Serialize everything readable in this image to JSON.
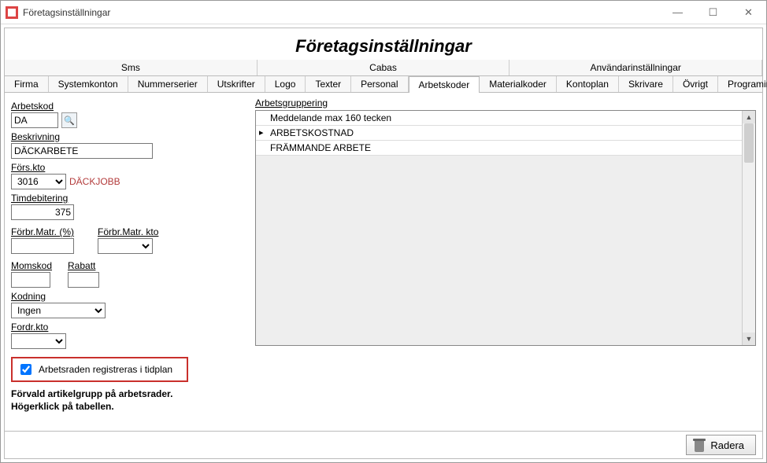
{
  "window": {
    "title": "Företagsinställningar"
  },
  "header": {
    "title": "Företagsinställningar"
  },
  "tabs_row1": [
    "Sms",
    "Cabas",
    "Användarinställningar"
  ],
  "tabs_row2": [
    "Firma",
    "Systemkonton",
    "Nummerserier",
    "Utskrifter",
    "Logo",
    "Texter",
    "Personal",
    "Arbetskoder",
    "Materialkoder",
    "Kontoplan",
    "Skrivare",
    "Övrigt",
    "Programinställningar"
  ],
  "active_tab_row2": "Arbetskoder",
  "left": {
    "arbetskod_label": "Arbetskod",
    "arbetskod_value": "DA",
    "beskrivning_label": "Beskrivning",
    "beskrivning_value": "DÄCKARBETE",
    "forskto_label": "Förs.kto",
    "forskto_value": "3016",
    "forskto_name": "DÄCKJOBB",
    "timdeb_label": "Timdebitering",
    "timdeb_value": "375",
    "forbr_pct_label": "Förbr.Matr. (%)",
    "forbr_pct_value": "",
    "forbr_kto_label": "Förbr.Matr. kto",
    "forbr_kto_value": "",
    "momskod_label": "Momskod",
    "momskod_value": "",
    "rabatt_label": "Rabatt",
    "rabatt_value": "",
    "kodning_label": "Kodning",
    "kodning_value": "Ingen",
    "fordrkto_label": "Fordr.kto",
    "fordrkto_value": "",
    "checkbox_label": "Arbetsraden registreras i tidplan",
    "checkbox_checked": true,
    "hint_line1": "Förvald artikelgrupp på arbetsrader.",
    "hint_line2": "Högerklick på tabellen."
  },
  "group": {
    "label": "Arbetsgruppering",
    "rows": [
      {
        "text": "Meddelande max 160 tecken",
        "selected": false
      },
      {
        "text": "ARBETSKOSTNAD",
        "selected": true
      },
      {
        "text": "FRÄMMANDE ARBETE",
        "selected": false
      }
    ]
  },
  "footer": {
    "radera": "Radera"
  }
}
